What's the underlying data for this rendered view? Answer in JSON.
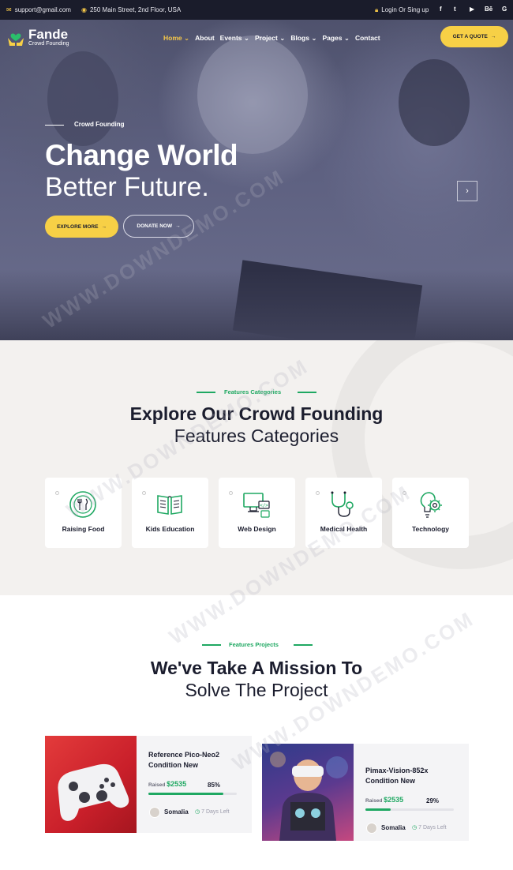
{
  "topbar": {
    "email": "support@gmail.com",
    "address": "250 Main Street, 2nd Floor, USA",
    "login": "Login Or Sing up",
    "social": [
      "f",
      "t",
      "▶",
      "Bē",
      "G"
    ]
  },
  "nav": {
    "logo_name": "Fande",
    "logo_tag": "Crowd Founding",
    "items": [
      {
        "label": "Home",
        "active": true,
        "caret": true
      },
      {
        "label": "About",
        "caret": false
      },
      {
        "label": "Events",
        "caret": true
      },
      {
        "label": "Project",
        "caret": true
      },
      {
        "label": "Blogs",
        "caret": true
      },
      {
        "label": "Pages",
        "caret": true
      },
      {
        "label": "Contact",
        "caret": false
      }
    ],
    "cta": "GET A QUOTE"
  },
  "hero": {
    "eyebrow": "Crowd Founding",
    "title_bold": "Change World",
    "title_light": "Better Future.",
    "explore": "EXPLORE MORE",
    "donate": "DONATE NOW",
    "next": "›"
  },
  "categories": {
    "eyebrow": "Features Categories",
    "title_bold": "Explore Our Crowd Founding",
    "title_light": "Features Categories",
    "items": [
      {
        "label": "Raising Food",
        "icon": "food-icon"
      },
      {
        "label": "Kids Education",
        "icon": "book-icon"
      },
      {
        "label": "Web Design",
        "icon": "web-design-icon"
      },
      {
        "label": "Medical Health",
        "icon": "stethoscope-icon"
      },
      {
        "label": "Technology",
        "icon": "technology-icon"
      }
    ]
  },
  "projects": {
    "eyebrow": "Features Projects",
    "title_bold": "We've Take A Mission To",
    "title_light": "Solve The Project",
    "items": [
      {
        "title_line1": "Reference Pico-Neo2",
        "title_line2": "Condition New",
        "raised_label": "Raised",
        "raised": "$2535",
        "percent_label": "85%",
        "percent": 0.85,
        "author": "Somalia",
        "days": "7 Days Left"
      },
      {
        "title_line1": "Pimax-Vision-852x",
        "title_line2": "Condition New",
        "raised_label": "Raised",
        "raised": "$2535",
        "percent_label": "29%",
        "percent": 0.29,
        "author": "Somalia",
        "days": "7 Days Left"
      }
    ]
  },
  "colors": {
    "accent_yellow": "#f7d046",
    "accent_green": "#1fa862",
    "dark": "#1a1c2b"
  },
  "watermark": "WWW.DOWNDEMO.COM"
}
